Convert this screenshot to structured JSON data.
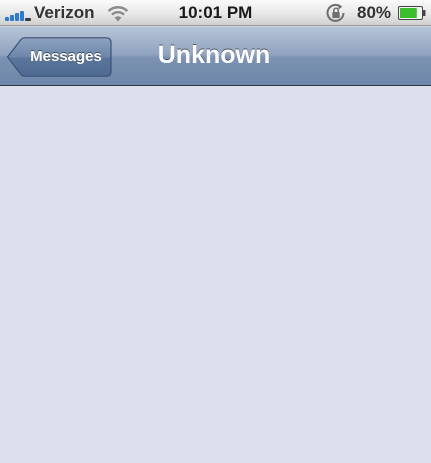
{
  "status_bar": {
    "carrier": "Verizon",
    "time": "10:01 PM",
    "battery_percent": "80%",
    "signal_icon": "signal-bars-icon",
    "wifi_icon": "wifi-icon",
    "rotation_lock_icon": "rotation-lock-icon",
    "battery_icon": "battery-icon",
    "battery_level": 0.8,
    "battery_color": "#3bbf2a",
    "signal_color": "#2b7bd6"
  },
  "nav_bar": {
    "back_label": "Messages",
    "title": "Unknown"
  },
  "content": {
    "background": "#dbe0ec"
  }
}
